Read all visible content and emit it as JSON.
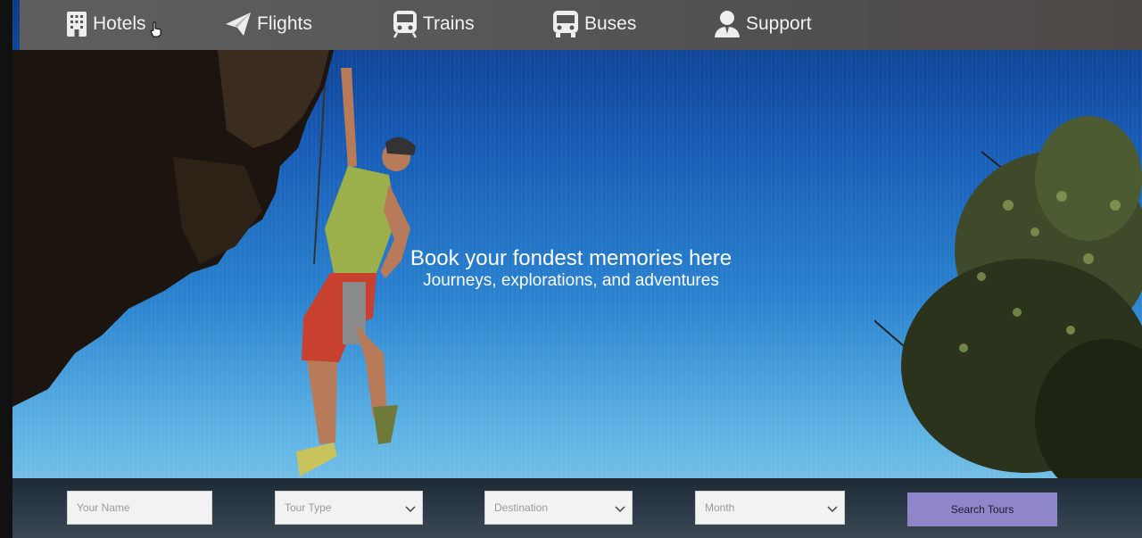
{
  "nav": {
    "items": [
      {
        "label": "Hotels",
        "icon": "building-icon"
      },
      {
        "label": "Flights",
        "icon": "paper-plane-icon"
      },
      {
        "label": "Trains",
        "icon": "train-icon"
      },
      {
        "label": "Buses",
        "icon": "bus-icon"
      },
      {
        "label": "Support",
        "icon": "support-agent-icon"
      }
    ]
  },
  "hero": {
    "headline": "Book your fondest memories here",
    "subline": "Journeys, explorations, and adventures"
  },
  "search": {
    "name_placeholder": "Your Name",
    "tour_type_placeholder": "Tour Type",
    "destination_placeholder": "Destination",
    "month_placeholder": "Month",
    "button_label": "Search Tours"
  },
  "colors": {
    "nav_bg": "#555555",
    "button_bg": "#8e86c8"
  }
}
